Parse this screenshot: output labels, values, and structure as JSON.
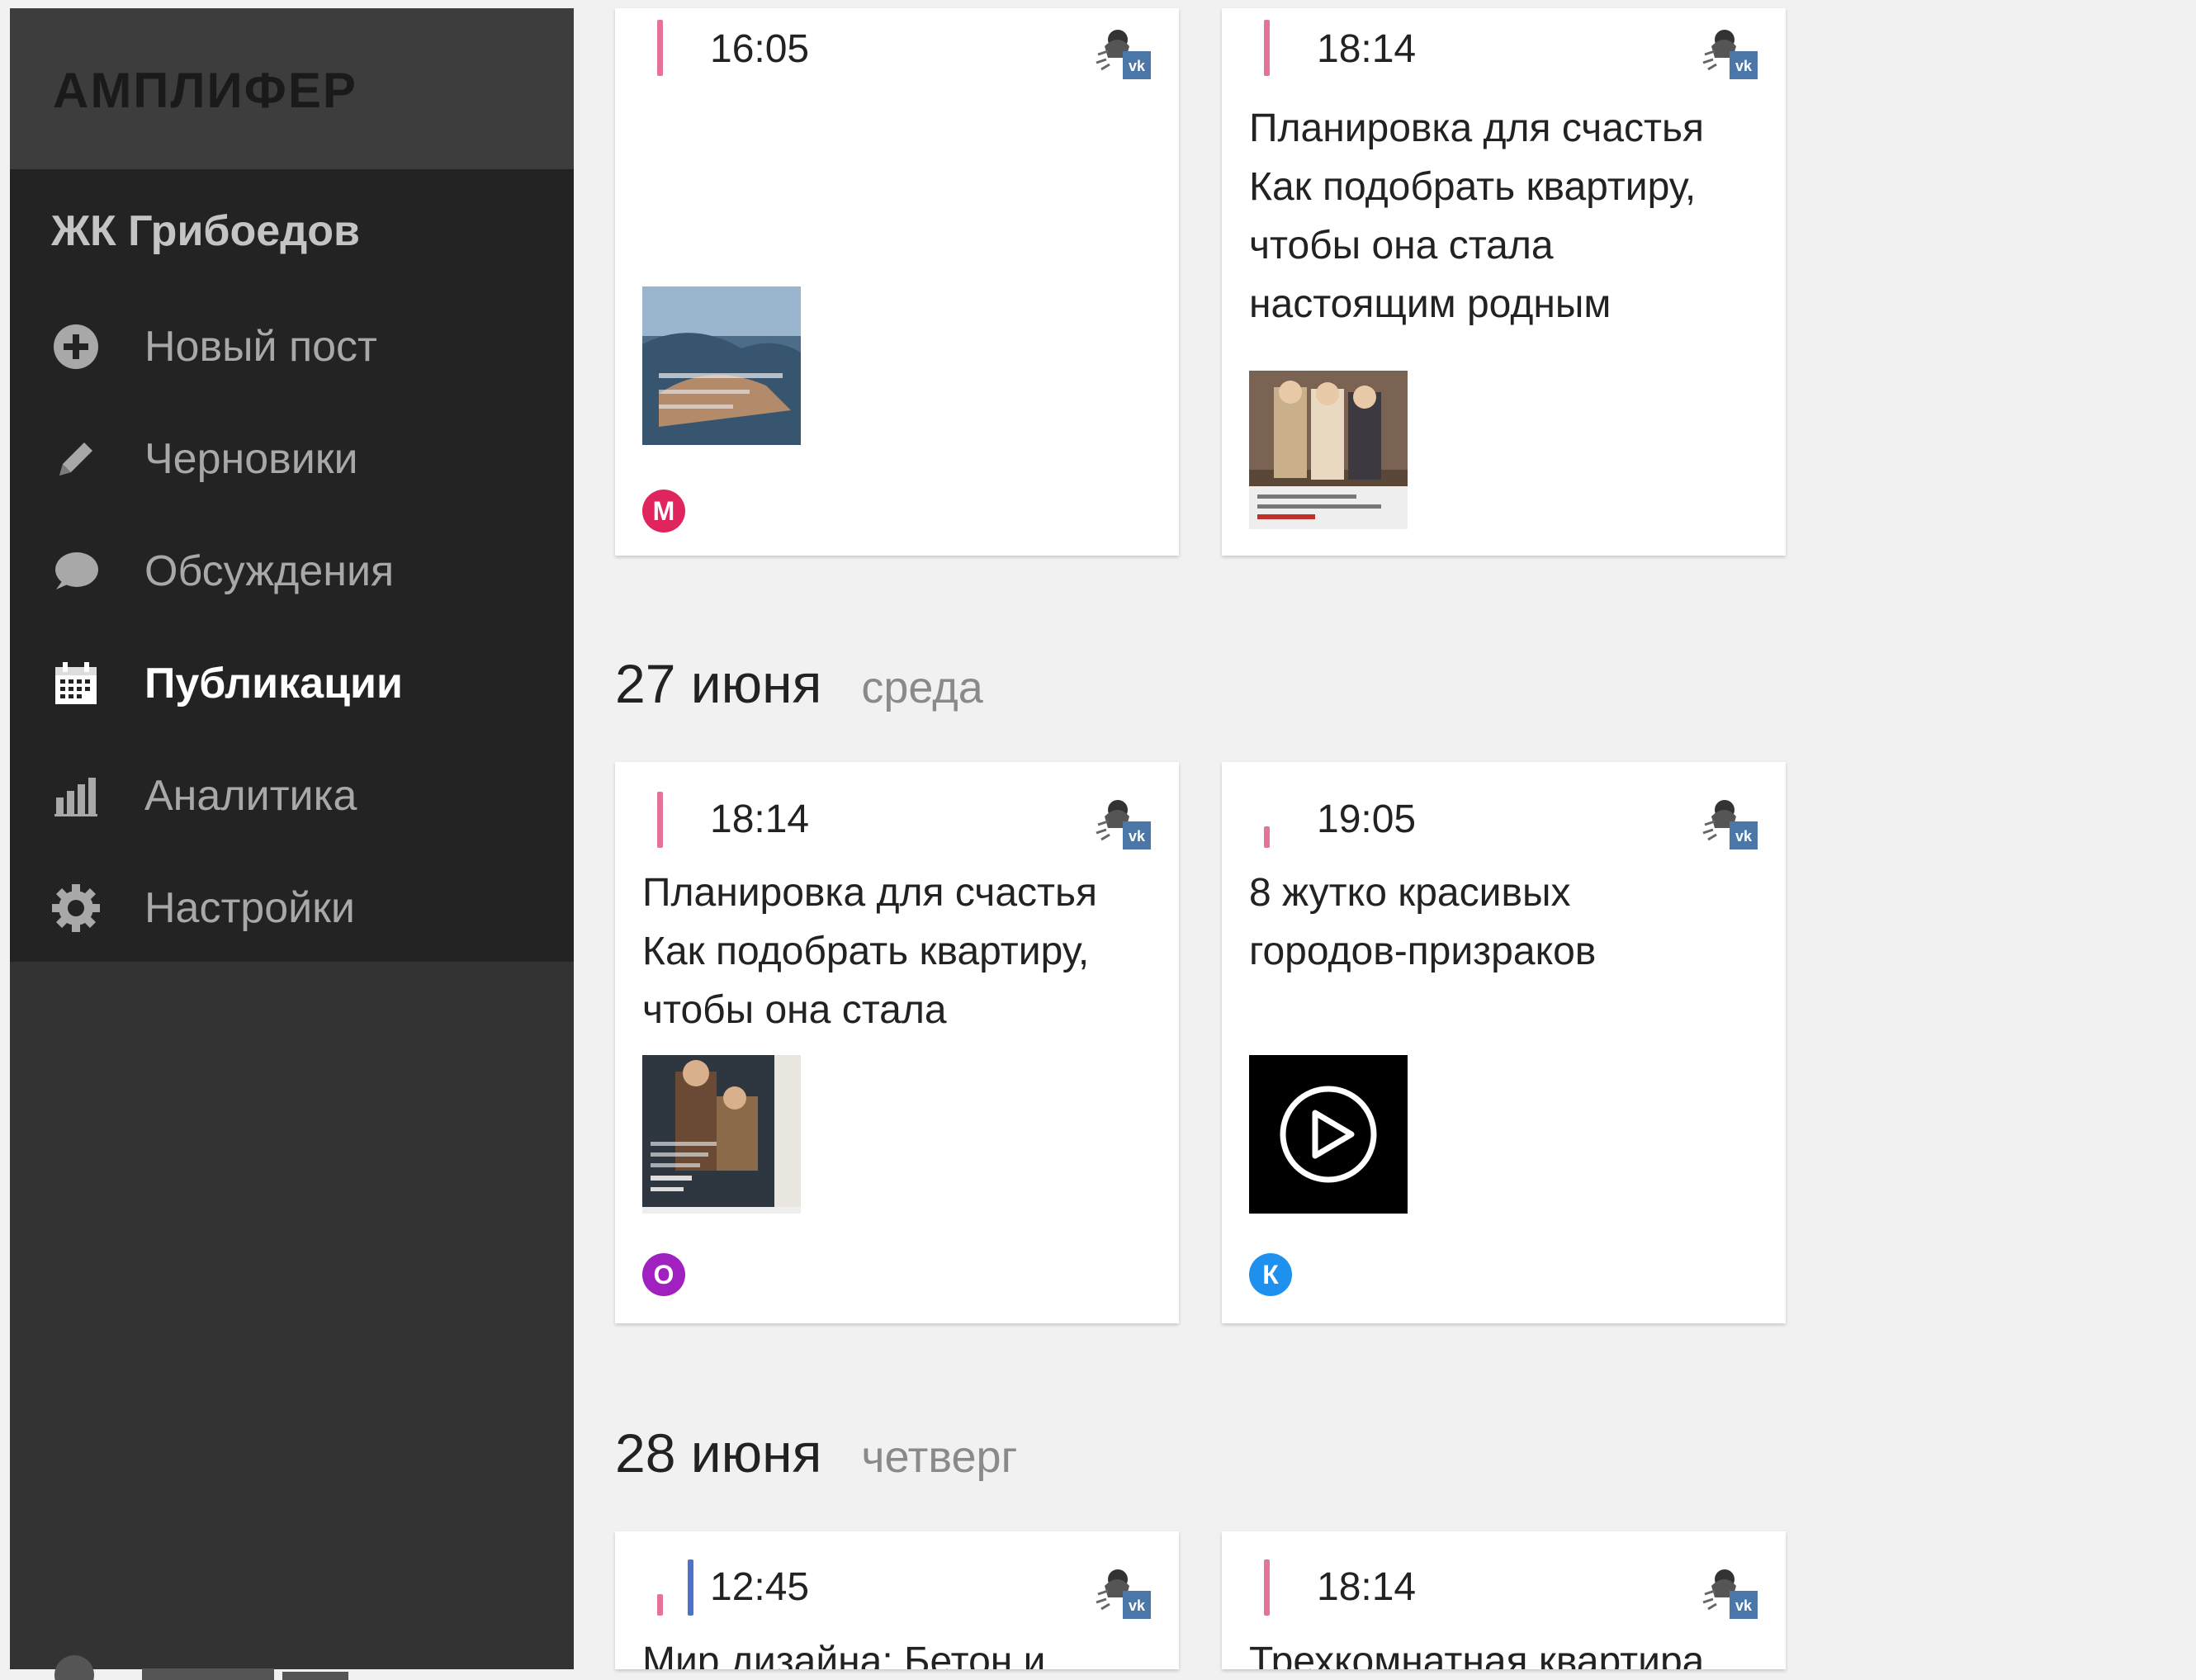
{
  "sidebar": {
    "brand": "АМПЛИФЕР",
    "project": "ЖК Грибоедов",
    "items": [
      {
        "label": "Новый пост",
        "icon": "plus-circle-icon"
      },
      {
        "label": "Черновики",
        "icon": "pencil-icon"
      },
      {
        "label": "Обсуждения",
        "icon": "chat-bubble-icon"
      },
      {
        "label": "Публикации",
        "icon": "calendar-icon",
        "active": true
      },
      {
        "label": "Аналитика",
        "icon": "bar-chart-icon"
      },
      {
        "label": "Настройки",
        "icon": "gear-icon"
      }
    ]
  },
  "days": [
    {
      "date": "27 июня",
      "weekday": "среда"
    },
    {
      "date": "28 июня",
      "weekday": "четверг"
    }
  ],
  "posts": [
    {
      "time": "16:05",
      "text": "",
      "avatar": "М",
      "avatar_color": "#e0245e",
      "thumb": "photo-yacht"
    },
    {
      "time": "18:14",
      "text": "Планировка для счастья\nКак подобрать квартиру,\nчтобы она стала\nнастоящим родным",
      "avatar": "",
      "thumb": "photo-family"
    },
    {
      "time": "18:14",
      "text": "Планировка для счастья\nКак подобрать квартиру,\nчтобы она стала",
      "avatar": "О",
      "avatar_color": "#a020c0",
      "thumb": "photo-couple"
    },
    {
      "time": "19:05",
      "text": "8 жутко красивых\nгородов-призраков",
      "avatar": "К",
      "avatar_color": "#1e90ee",
      "thumb": "video"
    },
    {
      "time": "12:45",
      "text": "Мир дизайна: Бетон и",
      "avatar": ""
    },
    {
      "time": "18:14",
      "text": "Трехкомнатная квартира",
      "avatar": ""
    }
  ],
  "colors": {
    "sidebar_bg": "#333333",
    "menu_bg": "#232323",
    "page_bg": "#f1f1f1",
    "status_pink": "#e57395",
    "status_blue": "#4a73c9"
  }
}
